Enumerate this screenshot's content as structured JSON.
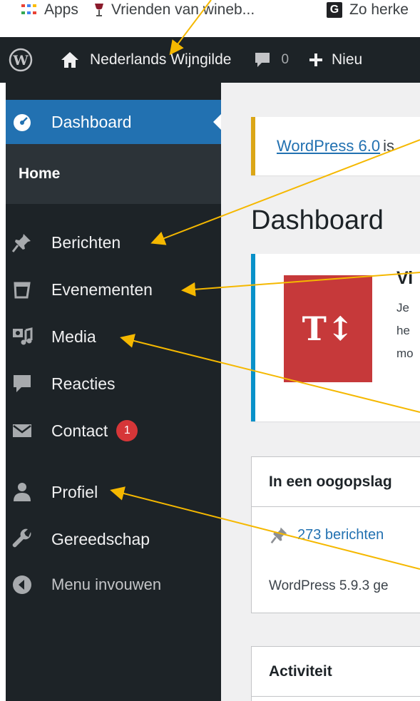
{
  "browser": {
    "bookmarks": [
      {
        "label": "Apps",
        "icon": "apps-grid-icon"
      },
      {
        "label": "Vrienden van wineb...",
        "icon": "wine-glass-icon"
      },
      {
        "label": "Zo herke",
        "icon": "g-icon"
      }
    ]
  },
  "adminbar": {
    "site_name": "Nederlands Wijngilde",
    "comments_count": "0",
    "new_label": "Nieu"
  },
  "sidebar": {
    "dashboard": "Dashboard",
    "home": "Home",
    "items": [
      {
        "label": "Berichten",
        "icon": "pushpin-icon"
      },
      {
        "label": "Evenementen",
        "icon": "calendar-icon"
      },
      {
        "label": "Media",
        "icon": "media-icon"
      },
      {
        "label": "Reacties",
        "icon": "comment-icon"
      },
      {
        "label": "Contact",
        "icon": "envelope-icon",
        "badge": "1"
      },
      {
        "label": "Profiel",
        "icon": "user-icon"
      },
      {
        "label": "Gereedschap",
        "icon": "wrench-icon"
      }
    ],
    "collapse": "Menu invouwen"
  },
  "main": {
    "notice_link": "WordPress 6.0",
    "notice_rest": "is",
    "title": "Dashboard",
    "welcome": {
      "logo_text": "T↕",
      "title": "Vi",
      "lines": [
        "Je",
        "he",
        "mo"
      ]
    },
    "glance": {
      "title": "In een oogopslag",
      "posts_link": "273 berichten",
      "version": "WordPress 5.9.3 ge"
    },
    "activity": {
      "title": "Activiteit"
    }
  },
  "colors": {
    "admin_bg": "#1d2327",
    "accent": "#2271b1",
    "badge": "#d63638",
    "annotation": "#f5b800"
  }
}
